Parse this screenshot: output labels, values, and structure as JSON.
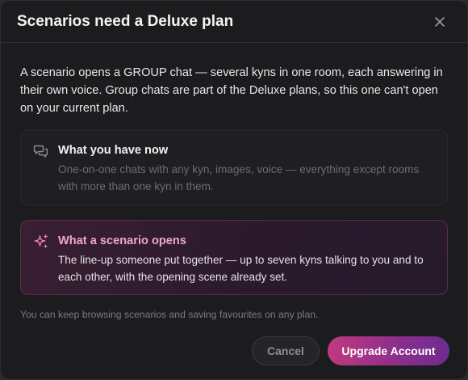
{
  "dialog": {
    "title": "Scenarios need a Deluxe plan",
    "intro": "A scenario opens a GROUP chat — several kyns in one room, each answering in their own voice. Group chats are part of the Deluxe plans, so this one can't open on your current plan.",
    "cards": [
      {
        "title": "What you have now",
        "description": "One-on-one chats with any kyn, images, voice — everything except rooms with more than one kyn in them.",
        "icon": "chat-bubbles-icon"
      },
      {
        "title": "What a scenario opens",
        "description": "The line-up someone put together — up to seven kyns talking to you and to each other, with the opening scene already set.",
        "icon": "sparkles-icon"
      }
    ],
    "footnote": "You can keep browsing scenarios and saving favourites on any plan.",
    "cancel_label": "Cancel",
    "upgrade_label": "Upgrade Account"
  },
  "colors": {
    "accent_pink": "#f0a6d2",
    "upgrade_gradient_start": "#c0397e",
    "upgrade_gradient_end": "#6d2c8f"
  }
}
